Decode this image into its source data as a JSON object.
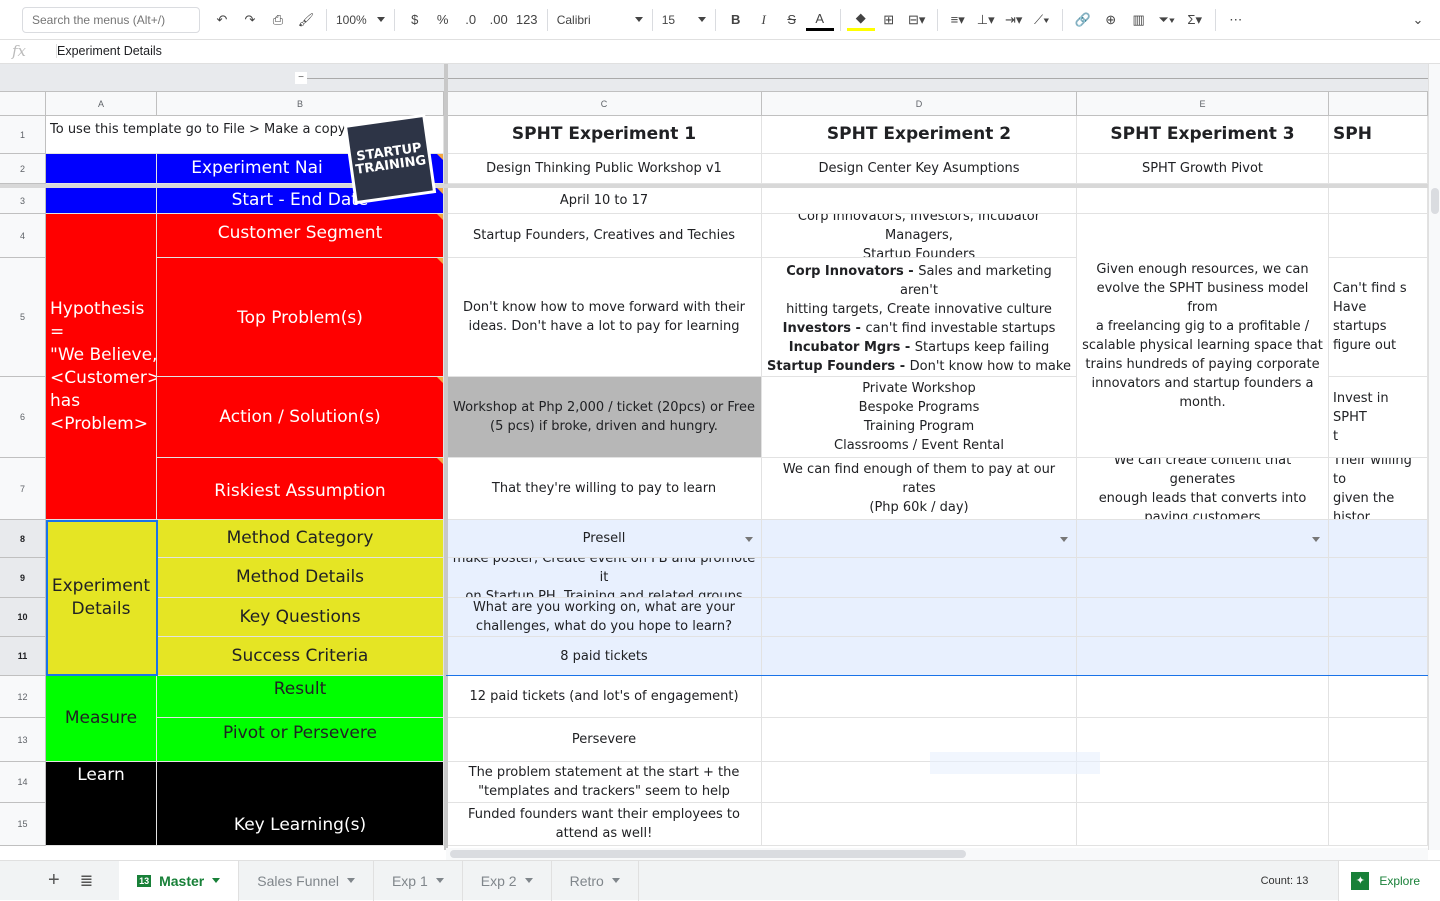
{
  "toolbar": {
    "search_placeholder": "Search the menus (Alt+/)",
    "zoom": "100%",
    "currency": "$",
    "percent": "%",
    "dec_decrease": ".0",
    "dec_increase": ".00",
    "more_formats": "123",
    "font": "Calibri",
    "font_size": "15",
    "icons": [
      "undo-icon",
      "redo-icon",
      "print-icon",
      "paint-format-icon",
      "bold-icon",
      "italic-icon",
      "strikethrough-icon",
      "text-color-icon",
      "fill-color-icon",
      "borders-icon",
      "merge-icon",
      "align-icon",
      "valign-icon",
      "wrap-icon",
      "rotate-icon",
      "link-icon",
      "comment-icon",
      "chart-icon",
      "filter-icon",
      "functions-icon",
      "more-icon",
      "collapse-icon"
    ],
    "colors": {
      "text_underline": "#000000",
      "fill_underline": "#ffff00"
    }
  },
  "formula_bar": {
    "fx": "fx",
    "value": "Experiment Details"
  },
  "columns": [
    "A",
    "B",
    "C",
    "D",
    "E"
  ],
  "rows": [
    "1",
    "2",
    "3",
    "4",
    "5",
    "6",
    "7",
    "8",
    "9",
    "10",
    "11",
    "12",
    "13",
    "14",
    "15"
  ],
  "logo_text": "STARTUP TRAINING",
  "cells": {
    "A1": "To use this template go to File > Make a copy",
    "C1": "SPHT Experiment 1",
    "D1": "SPHT Experiment 2",
    "E1": "SPHT Experiment 3",
    "F1": "SPH",
    "B2": "Experiment Nai",
    "C2": "Design Thinking Public Workshop v1",
    "D2": "Design Center Key Asumptions",
    "E2": "SPHT Growth Pivot",
    "B3": "Start - End Date",
    "C3": "April 10 to 17",
    "A4": "Hypothesis =\n\"We Believe,\n<Customer>\nhas\n<Problem>",
    "B4": "Customer Segment",
    "C4": "Startup Founders, Creatives and Techies",
    "D4": "Corp Innovators, Investors, Incubator Managers,\nStartup Founders",
    "E4": "Given enough resources, we can\nevolve the SPHT business model from\na freelancing gig to a profitable /\nscalable physical learning space that\ntrains hundreds of paying corporate\ninnovators and startup founders a\nmonth.",
    "B5": "Top Problem(s)",
    "C5": "Don't know how to move forward with their\nideas. Don't have a lot to pay for learning",
    "D5": [
      {
        "b": "Corp Innovators - ",
        "t": "Sales and marketing aren't\nhitting targets, Create innovative culture"
      },
      {
        "b": "\nInvestors - ",
        "t": "can't find investable startups"
      },
      {
        "b": "\nIncubator Mgrs - ",
        "t": "Startups keep failing"
      },
      {
        "b": "\nStartup Founders - ",
        "t": "Don't know how to make\nidea succeed"
      }
    ],
    "F5": "Can't find s\nHave startups\nfigure out",
    "B6": "Action / Solution(s)",
    "C6": "Workshop at Php 2,000 / ticket (20pcs) or Free\n(5 pcs) if broke, driven and hungry.",
    "D6": "Private Workshop\nBespoke Programs\nTraining Program\nClassrooms / Event Rental",
    "F6": "Invest in SPHT\nt",
    "B7": "Riskiest Assumption",
    "C7": "That they're willing to pay to learn",
    "D7": "We can find enough of them to pay at our rates\n(Php 60k / day)",
    "E7": "We can create content that generates\nenough leads that converts into\npaying customers",
    "F7": "Their willing to\ngiven the histor",
    "A8": "Experiment\nDetails",
    "B8": "Method Category",
    "C8": "Presell",
    "B9": "Method Details",
    "C9": "make poster, Create event on FB and promote it\non Startup PH, Training and related groups",
    "B10": "Key Questions",
    "C10": "What are you working on, what are your\nchallenges, what do you hope to learn?",
    "B11": "Success Criteria",
    "C11": "8 paid tickets",
    "A12": "Measure",
    "B12": "Result",
    "C12": "12 paid tickets (and lot's of engagement)",
    "B13": "Pivot or Persevere",
    "C13": "Persevere",
    "A14": "Learn",
    "B14": "Key Learning(s)",
    "C14": "The problem statement at the start + the\n\"templates and trackers\" seem to help",
    "C15": "Funded founders want their employees to\nattend as well!"
  },
  "fill_colors": {
    "red": "#ff0000",
    "blue": "#0000ff",
    "yellow": "#e5e524",
    "green": "#00ff00",
    "black": "#000000",
    "gray": "#b7b7b7",
    "selection": "#e8f0fe"
  },
  "sheet_tabs": [
    {
      "label": "Master",
      "active": true
    },
    {
      "label": "Sales Funnel"
    },
    {
      "label": "Exp 1"
    },
    {
      "label": "Exp 2"
    },
    {
      "label": "Retro"
    }
  ],
  "status": {
    "count": "Count: 13",
    "explore": "Explore"
  }
}
